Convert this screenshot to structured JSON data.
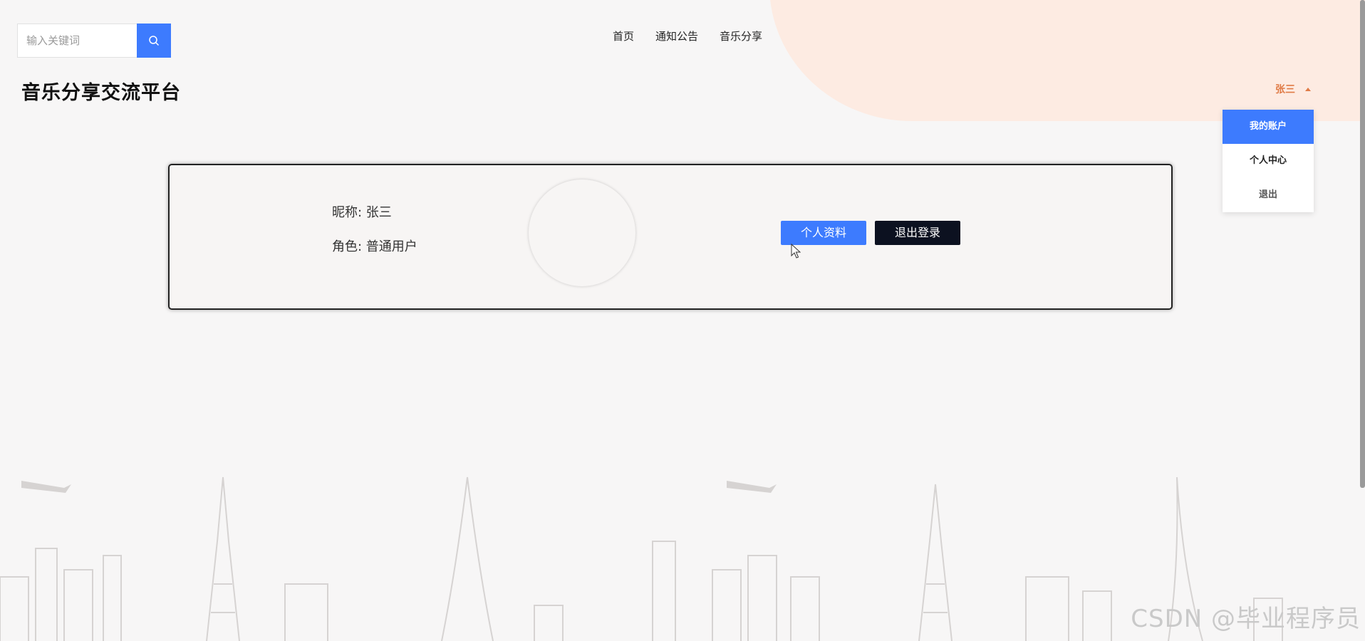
{
  "search": {
    "placeholder": "输入关键词"
  },
  "nav": {
    "items": [
      "首页",
      "通知公告",
      "音乐分享"
    ]
  },
  "site_title": "音乐分享交流平台",
  "user_menu": {
    "username": "张三",
    "items": [
      "我的账户",
      "个人中心",
      "退出"
    ]
  },
  "profile": {
    "nickname_line": "昵称: 张三",
    "role_line": "角色: 普通用户",
    "profile_button": "个人资料",
    "logout_button": "退出登录"
  },
  "watermark": "CSDN @毕业程序员",
  "colors": {
    "primary": "#3d7bfe",
    "dark": "#0c1120",
    "accent": "#e07b46"
  }
}
